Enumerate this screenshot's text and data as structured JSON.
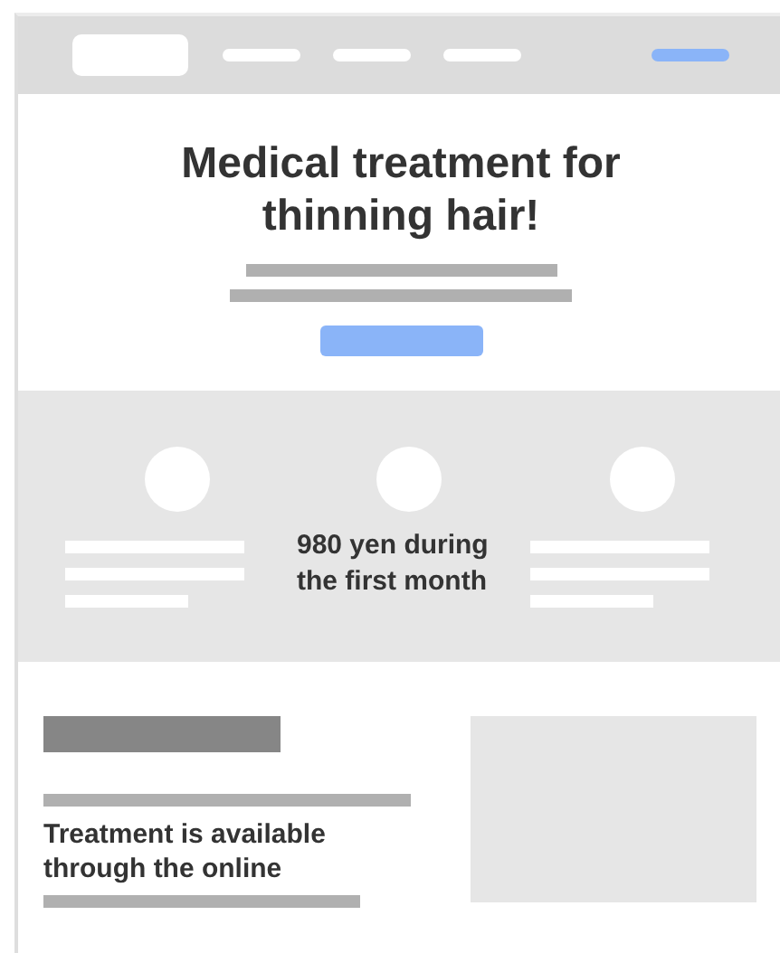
{
  "hero": {
    "title": "Medical treatment for thinning hair!"
  },
  "features": {
    "text": "980 yen during the first month"
  },
  "info": {
    "text": "Treatment is available through the online"
  }
}
